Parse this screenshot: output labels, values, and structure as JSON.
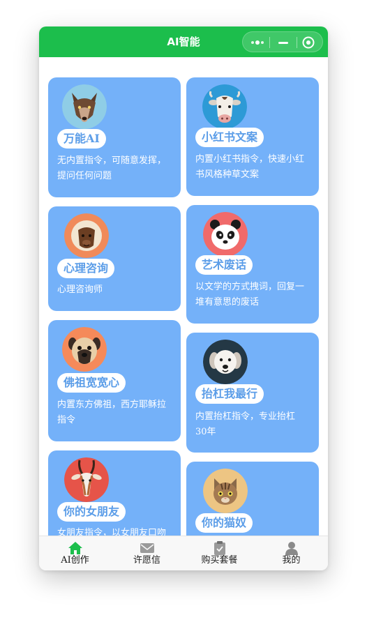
{
  "window": {
    "title": "AI智能"
  },
  "cards": [
    {
      "title": "万能AI",
      "desc": "无内置指令，可随意发挥，提问任何问题",
      "icon": "wolf-icon",
      "bg": "#8fcde6"
    },
    {
      "title": "小红书文案",
      "desc": "内置小红书指令，快速小红书风格种草文案",
      "icon": "cow-icon",
      "bg": "#2d9ad6"
    },
    {
      "title": "心理咨询",
      "desc": "心理咨询师",
      "icon": "monkey-icon",
      "bg": "#f08a5a"
    },
    {
      "title": "艺术废话",
      "desc": "以文学的方式拽词，回复一堆有意思的废话",
      "icon": "panda-icon",
      "bg": "#f06a6a"
    },
    {
      "title": "佛祖宽宽心",
      "desc": "内置东方佛祖，西方耶稣拉指令",
      "icon": "pug-icon",
      "bg": "#f58a5a"
    },
    {
      "title": "抬杠我最行",
      "desc": "内置抬杠指令，专业抬杠30年",
      "icon": "dog-icon",
      "bg": "#243845"
    },
    {
      "title": "你的女朋友",
      "desc": "女朋友指令，以女朋友口吻和你聊天",
      "icon": "antelope-icon",
      "bg": "#e65449"
    },
    {
      "title": "你的猫奴",
      "desc": "",
      "icon": "cat-icon",
      "bg": "#edc583"
    }
  ],
  "tabs": [
    {
      "label": "AI创作",
      "icon": "home-icon",
      "active": true
    },
    {
      "label": "许愿信",
      "icon": "mail-icon",
      "active": false
    },
    {
      "label": "购买套餐",
      "icon": "clipboard-icon",
      "active": false
    },
    {
      "label": "我的",
      "icon": "user-icon",
      "active": false
    }
  ],
  "colors": {
    "titlebar": "#1cbe4c",
    "card": "#74b1f9",
    "pill_text": "#5b9de8",
    "tab_active": "#1cbe4c",
    "tab_inactive": "#9a9a9a"
  }
}
